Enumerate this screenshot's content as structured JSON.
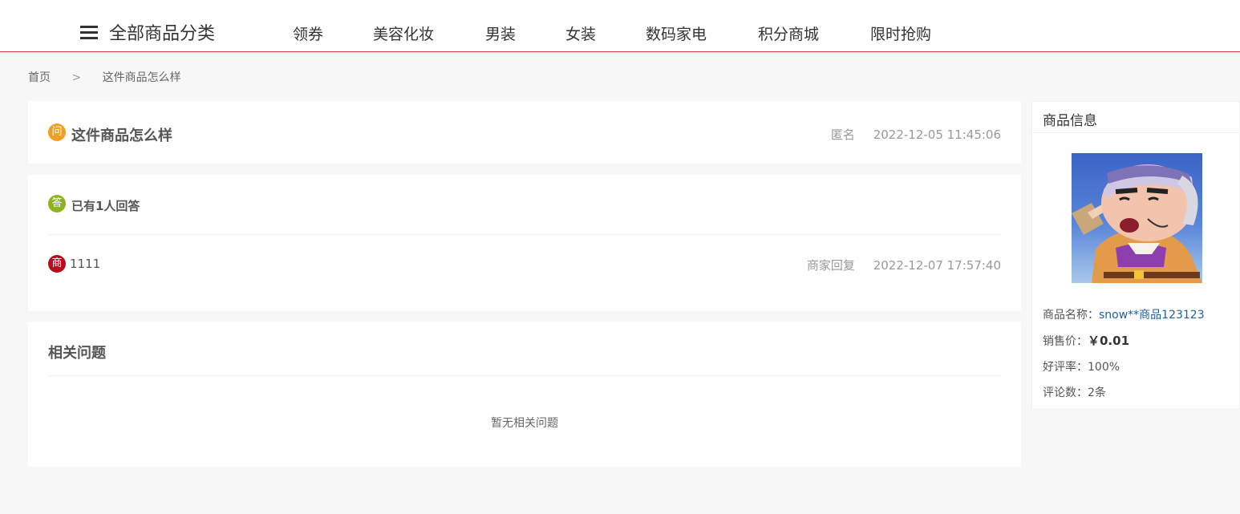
{
  "nav": {
    "all_categories": "全部商品分类",
    "items": [
      "领券",
      "美容化妆",
      "男装",
      "女装",
      "数码家电",
      "积分商城",
      "限时抢购"
    ]
  },
  "breadcrumb": {
    "home": "首页",
    "separator": ">",
    "current": "这件商品怎么样"
  },
  "question": {
    "badge": "问",
    "title": "这件商品怎么样",
    "author": "匿名",
    "time": "2022-12-05 11:45:06"
  },
  "answers": {
    "badge": "答",
    "count_text": "已有1人回答",
    "items": [
      {
        "badge": "商",
        "text": "1111",
        "author": "商家回复",
        "time": "2022-12-07 17:57:40"
      }
    ]
  },
  "related": {
    "title": "相关问题",
    "empty_text": "暂无相关问题"
  },
  "product": {
    "panel_title": "商品信息",
    "name_label": "商品名称：",
    "name_value": "snow**商品123123",
    "price_label": "销售价：",
    "price_value": "￥0.01",
    "rating_label": "好评率：",
    "rating_value": "100%",
    "reviews_label": "评论数：",
    "reviews_value": "2条"
  },
  "colors": {
    "accent": "#e4393c",
    "question_badge": "#f0a020",
    "answer_badge": "#8ab520",
    "merchant_badge": "#b80c1c",
    "link": "#1f5fa3"
  }
}
